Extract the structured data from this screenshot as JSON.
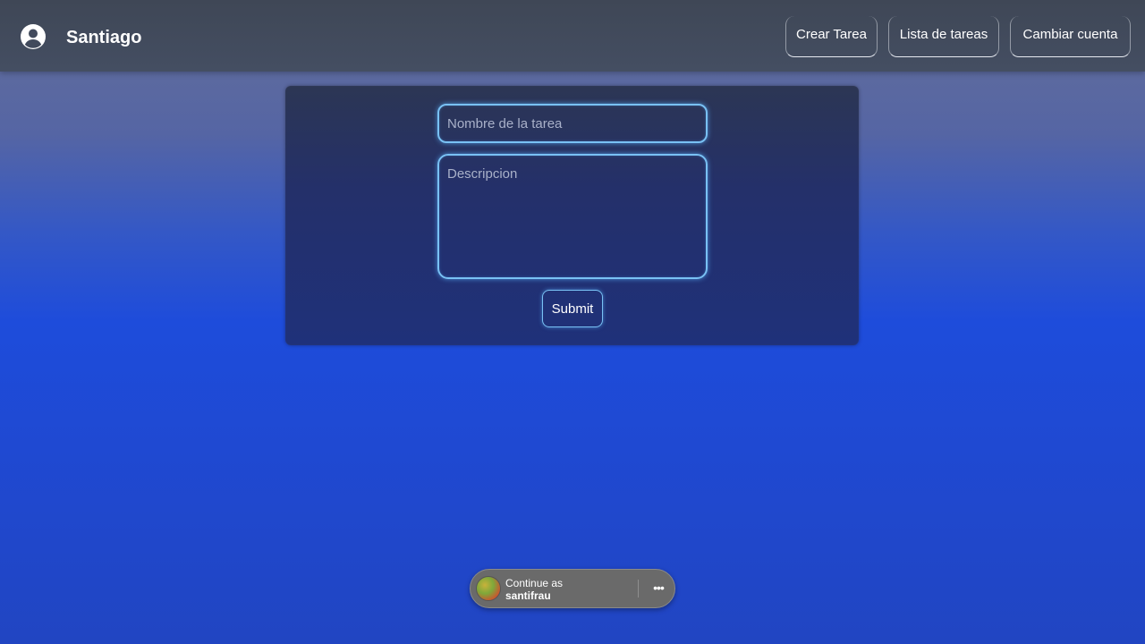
{
  "header": {
    "username": "Santiago",
    "avatar_icon": "account-circle-icon",
    "nav": [
      {
        "label": "Crear Tarea"
      },
      {
        "label": "Lista de tareas"
      },
      {
        "label": "Cambiar cuenta"
      }
    ]
  },
  "form": {
    "name_placeholder": "Nombre de la tarea",
    "description_placeholder": "Descripcion",
    "submit_label": "Submit"
  },
  "account_prompt": {
    "line1": "Continue as",
    "line2": "santifrau",
    "more_icon": "more-horizontal-icon"
  },
  "colors": {
    "header_bg": "#414a5c",
    "accent_border": "#79c1f4",
    "background_blue": "#1f49d2"
  }
}
